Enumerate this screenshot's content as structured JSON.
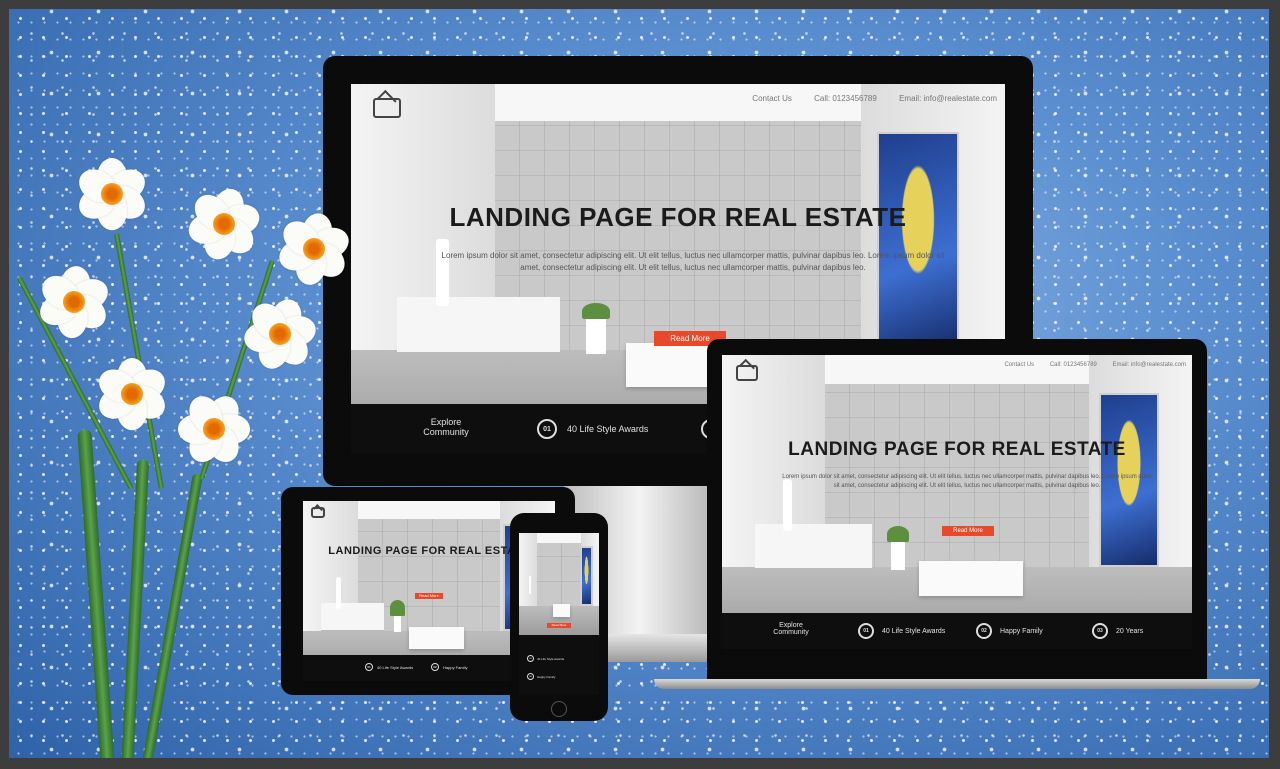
{
  "hero": {
    "title": "LANDING PAGE FOR REAL ESTATE",
    "subtitle": "Lorem ipsum dolor sit amet, consectetur adipiscing elit. Ut elit tellus, luctus nec ullamcorper mattis, pulvinar dapibus leo. Lorem ipsum dolor sit amet, consectetur adipiscing elit. Ut elit tellus, luctus nec ullamcorper mattis, pulvinar dapibus leo.",
    "button": "Read More"
  },
  "nav": {
    "contact": "Contact Us",
    "call": "Call: 0123456789",
    "email": "Email: info@realestate.com"
  },
  "stats": {
    "explore": "Explore Community",
    "items": [
      {
        "num": "01",
        "label": "40 Life Style Awards"
      },
      {
        "num": "02",
        "label": "Happy Family"
      },
      {
        "num": "03",
        "label": "20 Years"
      }
    ]
  },
  "colors": {
    "accent": "#e8492a",
    "footer": "#0e0e0e",
    "background": "#4a7fc4"
  }
}
